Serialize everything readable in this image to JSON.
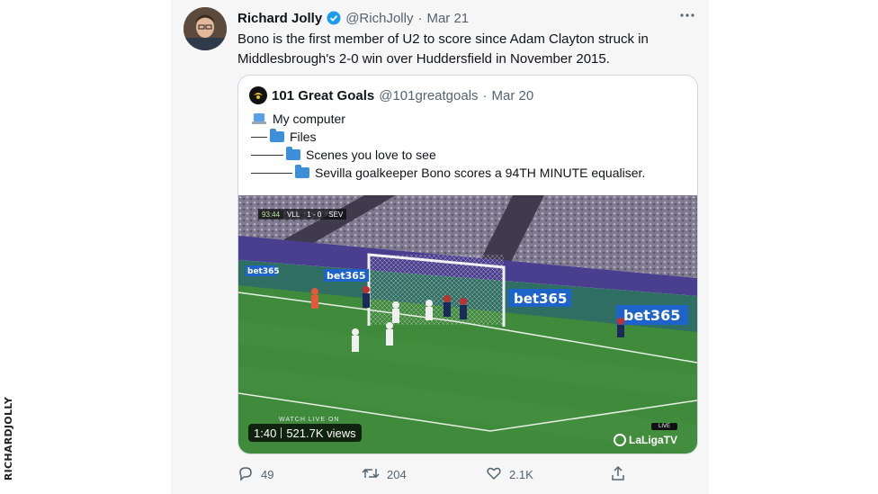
{
  "credit": "RICHARDJOLLY",
  "tweet": {
    "author_name": "Richard Jolly",
    "handle": "@RichJolly",
    "separator": "·",
    "date": "Mar 21",
    "more_icon": "more-icon",
    "text": "Bono is the first member of U2 to score since Adam Clayton struck in Middlesbrough's 2-0 win over Huddersfield in November 2015."
  },
  "quoted": {
    "author_name": "101 Great Goals",
    "handle": "@101greatgoals",
    "separator": "·",
    "date": "Mar 20",
    "lines": [
      "My computer",
      "Files",
      "Scenes you love to see",
      "Sevilla goalkeeper Bono scores a 94TH MINUTE equaliser."
    ],
    "video": {
      "duration": "1:40",
      "views": "521.7K views",
      "watermark": "LaLigaTV",
      "live_badge": "LIVE",
      "watch_text": "WATCH LIVE ON",
      "scoreboard": {
        "time": "93:44",
        "home": "VLL",
        "score": "1 - 0",
        "away": "SEV"
      },
      "board_texts": [
        "bet365",
        "bet365",
        "bet365",
        "bet365"
      ]
    }
  },
  "actions": {
    "reply_count": "49",
    "retweet_count": "204",
    "like_count": "2.1K"
  },
  "colors": {
    "tweet_bg": "#f6f6f6",
    "verified": "#1d9bf0",
    "secondary_text": "#536471",
    "folder": "#3d8fd9",
    "pitch": "#3f8a3b"
  }
}
